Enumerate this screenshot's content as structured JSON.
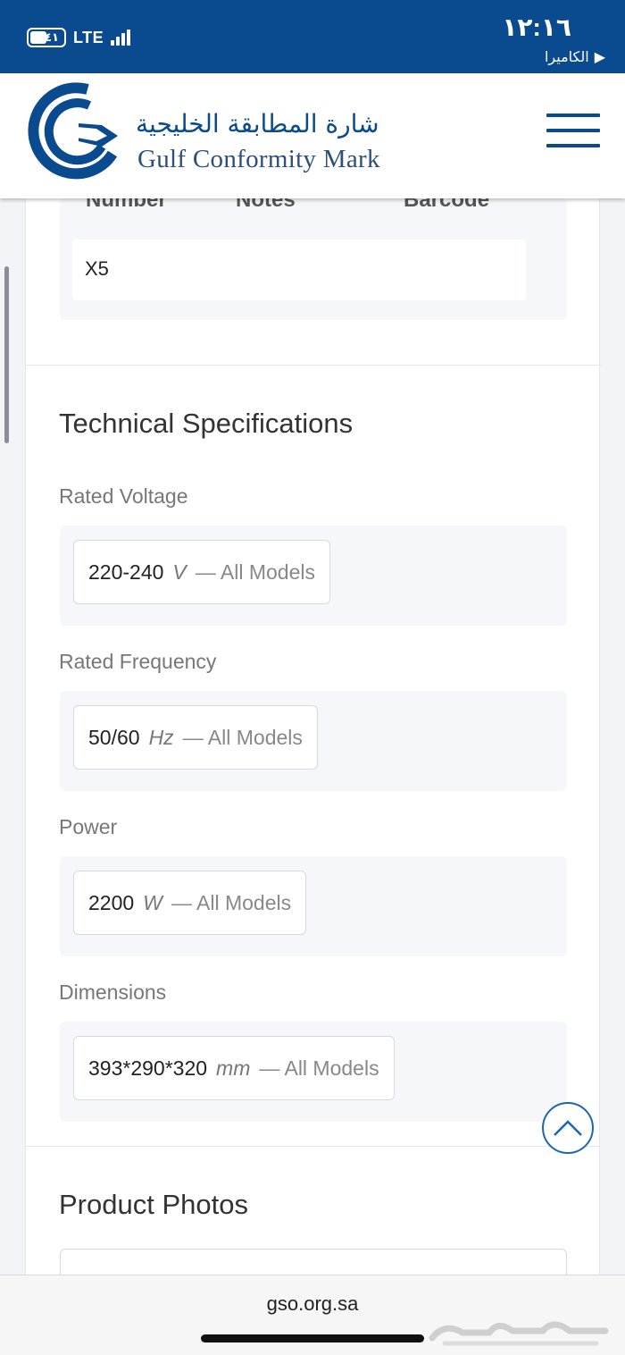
{
  "status_bar": {
    "battery_level": "٤١",
    "network": "LTE",
    "time": "١٢:١٦",
    "back_label": "الكاميرا"
  },
  "header": {
    "title_ar": "شارة المطابقة الخليجية",
    "title_en": "Gulf Conformity Mark"
  },
  "models_table": {
    "columns": [
      "Number",
      "Notes",
      "Barcode"
    ],
    "rows": [
      {
        "number": "X5",
        "notes": "",
        "barcode": ""
      }
    ]
  },
  "technical_specifications": {
    "title": "Technical Specifications",
    "items": [
      {
        "label": "Rated Voltage",
        "value": "220-240",
        "unit": "V",
        "models": "— All Models"
      },
      {
        "label": "Rated Frequency",
        "value": "50/60",
        "unit": "Hz",
        "models": "— All Models"
      },
      {
        "label": "Power",
        "value": "2200",
        "unit": "W",
        "models": "— All Models"
      },
      {
        "label": "Dimensions",
        "value": "393*290*320",
        "unit": "mm",
        "models": "— All Models"
      }
    ]
  },
  "product_photos": {
    "title": "Product Photos"
  },
  "browser": {
    "url": "gso.org.sa"
  },
  "colors": {
    "brand": "#0a4a8e",
    "accent": "#1b66b3",
    "panel": "#f5f7fa"
  },
  "icons": [
    "battery-icon",
    "signal-icon",
    "play-back-icon",
    "gso-logo-icon",
    "hamburger-menu-icon",
    "chevron-up-icon"
  ]
}
